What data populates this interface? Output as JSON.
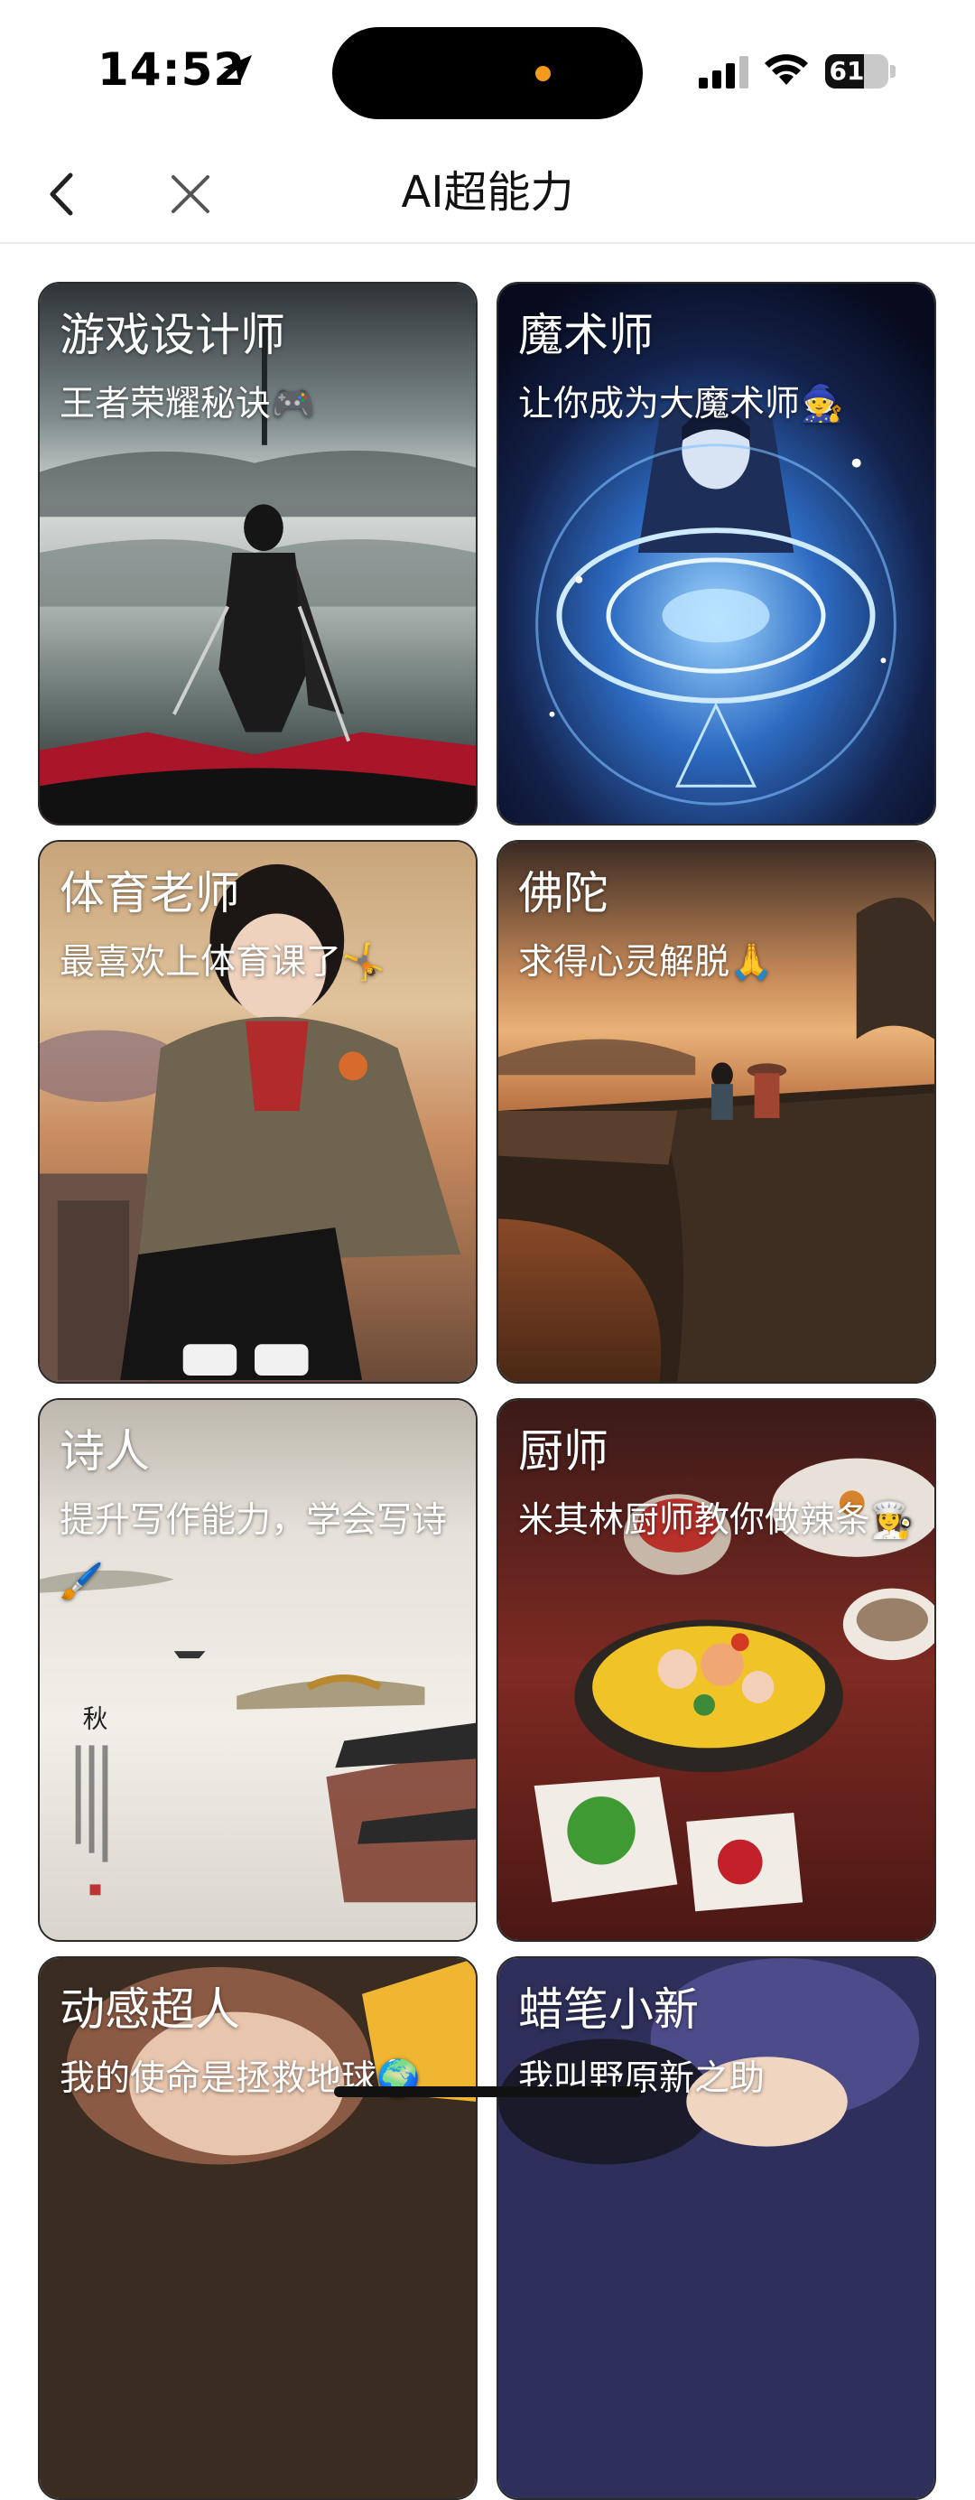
{
  "status_bar": {
    "time": "14:52",
    "battery": "61",
    "battery_level": 0.61,
    "icons": [
      "location-arrow-icon",
      "signal-icon",
      "wifi-icon",
      "battery-icon"
    ]
  },
  "nav": {
    "title": "AI超能力",
    "icons": [
      "back-chevron-icon",
      "close-x-icon"
    ]
  },
  "cards": [
    {
      "title": "游戏设计师",
      "subtitle": "王者荣耀秘诀🎮"
    },
    {
      "title": "魔术师",
      "subtitle": "让你成为大魔术师🧙"
    },
    {
      "title": "体育老师",
      "subtitle": "最喜欢上体育课了🤸"
    },
    {
      "title": "佛陀",
      "subtitle": "求得心灵解脱🙏"
    },
    {
      "title": "诗人",
      "subtitle": "提升写作能力，学会写诗🖌️"
    },
    {
      "title": "厨师",
      "subtitle": "米其林厨师教你做辣条👩‍🍳"
    },
    {
      "title": "动感超人",
      "subtitle": "我的使命是拯救地球🌍"
    },
    {
      "title": "蜡笔小新",
      "subtitle": "我叫野原新之助"
    }
  ]
}
